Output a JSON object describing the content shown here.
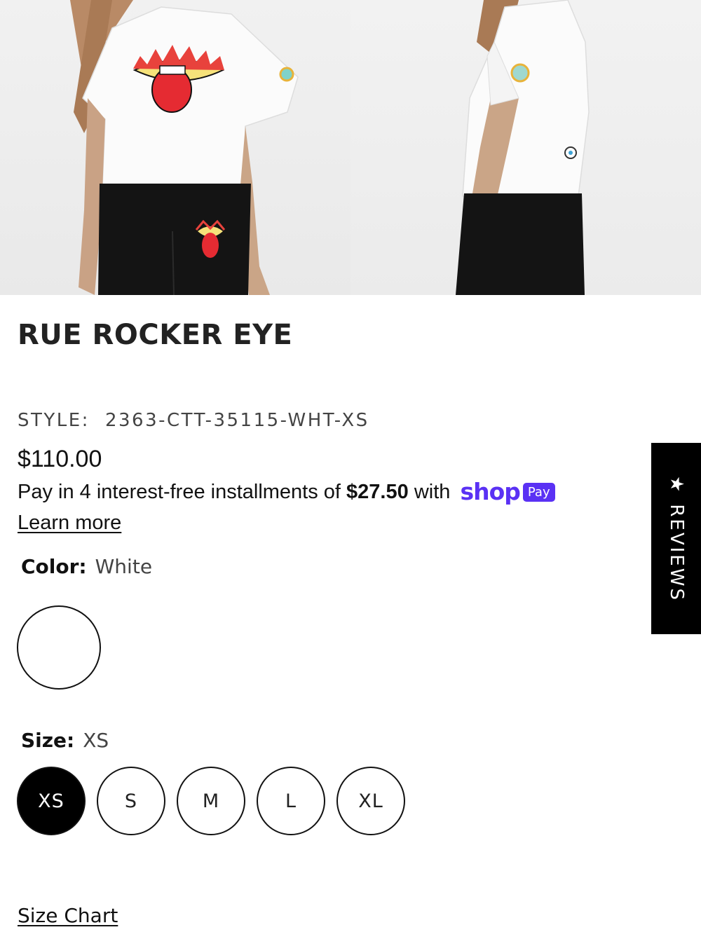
{
  "product": {
    "title": "RUE ROCKER EYE",
    "style_label": "STYLE:",
    "style_code": "2363-CTT-35115-WHT-XS",
    "price": "$110.00"
  },
  "installments": {
    "text_before": "Pay in 4 interest-free installments of",
    "amount": "$27.50",
    "text_after": "with",
    "shop_logo": "shop",
    "pay_badge": "Pay",
    "learn_more": "Learn more"
  },
  "color": {
    "label": "Color:",
    "value": "White",
    "swatch_hex": "#ffffff"
  },
  "size": {
    "label": "Size:",
    "value": "XS",
    "options": [
      "XS",
      "S",
      "M",
      "L",
      "XL"
    ]
  },
  "size_chart_label": "Size Chart",
  "reviews_tab": {
    "star": "★",
    "label": "REVIEWS"
  },
  "colors": {
    "shoppay_purple": "#5a31f4",
    "selected_size_bg": "#000000"
  }
}
